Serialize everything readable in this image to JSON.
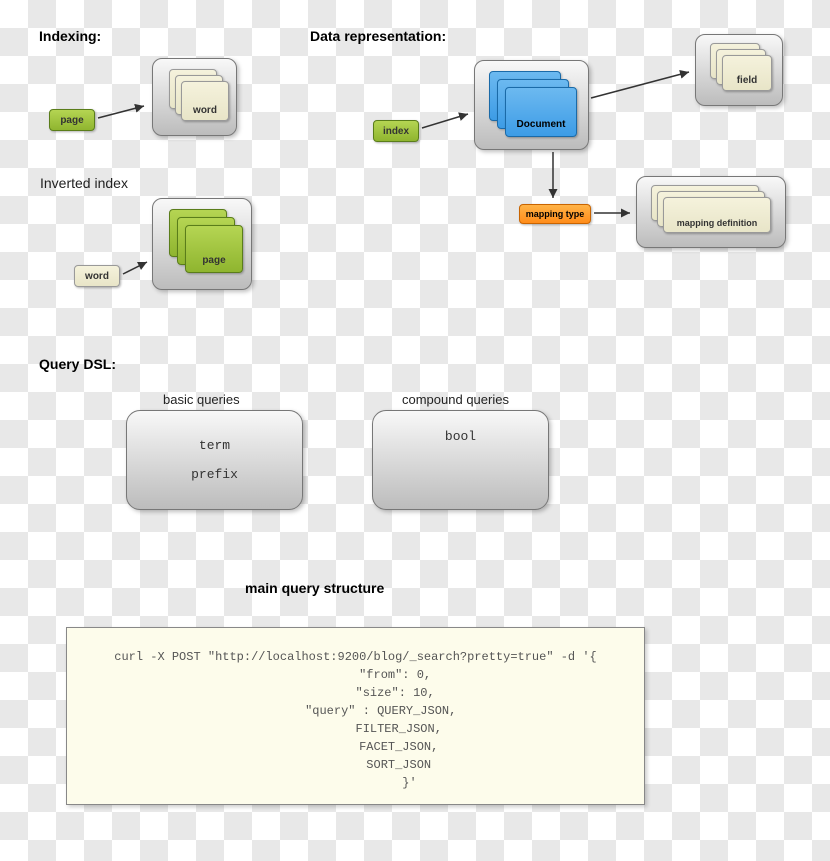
{
  "headings": {
    "indexing": "Indexing:",
    "data_rep": "Data representation:",
    "inverted": "Inverted index",
    "query_dsl": "Query DSL:",
    "basic_queries": "basic queries",
    "compound_queries": "compound queries",
    "main_query": "main query structure"
  },
  "chips": {
    "page": "page",
    "word": "word",
    "index": "index",
    "document": "Document",
    "field": "field",
    "mapping_type": "mapping type",
    "mapping_def": "mapping definition"
  },
  "queries": {
    "term": "term",
    "prefix": "prefix",
    "bool": "bool"
  },
  "code": "curl -X POST \"http://localhost:9200/blog/_search?pretty=true\" -d '{\n           \"from\": 0,\n           \"size\": 10,\n       \"query\" : QUERY_JSON,\n            FILTER_JSON,\n            FACET_JSON,\n            SORT_JSON\n               }'"
}
